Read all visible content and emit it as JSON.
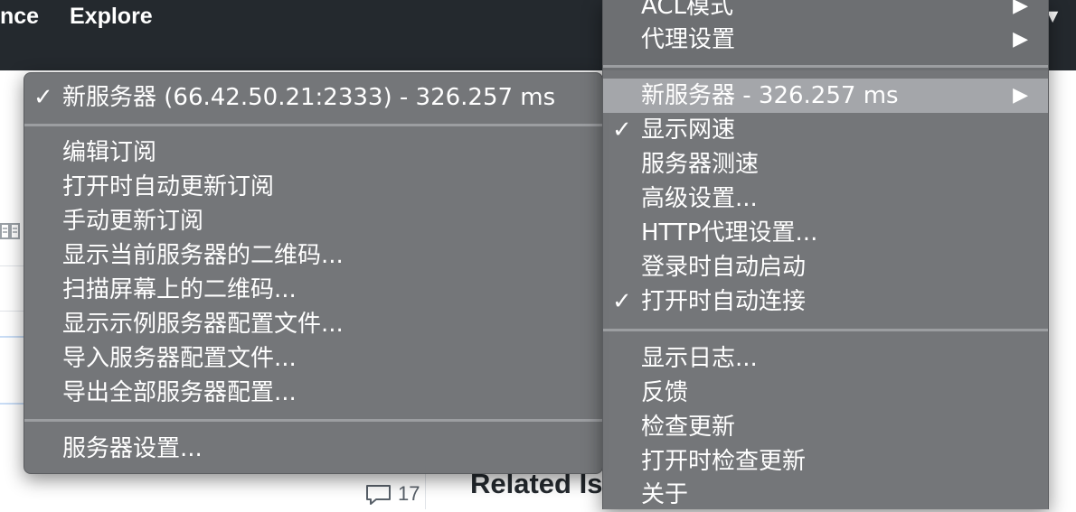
{
  "header": {
    "nav": [
      "nce",
      "Explore"
    ]
  },
  "background": {
    "comment_count": "17",
    "related_heading": "Related Is"
  },
  "left_menu": {
    "current_server": "新服务器 (66.42.50.21:2333) - 326.257 ms",
    "items": [
      "编辑订阅",
      "打开时自动更新订阅",
      "手动更新订阅",
      "显示当前服务器的二维码...",
      "扫描屏幕上的二维码...",
      "显示示例服务器配置文件...",
      "导入服务器配置文件...",
      "导出全部服务器配置..."
    ],
    "server_settings": "服务器设置..."
  },
  "right_menu": {
    "acl_mode": "ACL模式",
    "proxy_settings": "代理设置",
    "server_item": "新服务器  - 326.257 ms",
    "show_speed": "显示网速",
    "server_speed_test": "服务器测速",
    "advanced_settings": "高级设置...",
    "http_proxy_settings": "HTTP代理设置...",
    "launch_at_login": "登录时自动启动",
    "auto_connect_on_open": "打开时自动连接",
    "show_log": "显示日志...",
    "feedback": "反馈",
    "check_updates": "检查更新",
    "check_updates_on_open": "打开时检查更新",
    "about": "关于"
  },
  "symbols": {
    "check": "✓",
    "submenu_arrow": "▶"
  },
  "colors": {
    "topbar": "#24292e",
    "menu_bg": "#707275",
    "menu_highlight": "#aaacaf"
  }
}
